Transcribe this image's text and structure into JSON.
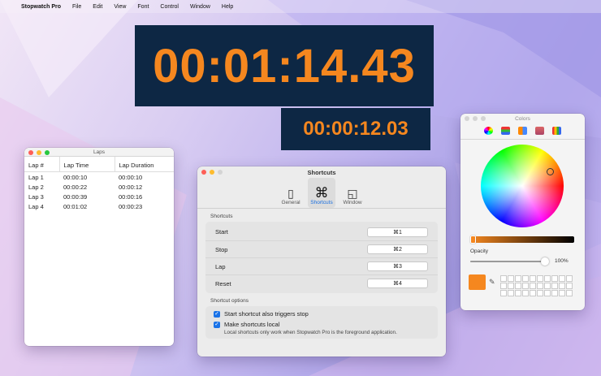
{
  "menubar": {
    "apple": "",
    "app_name": "Stopwatch Pro",
    "items": [
      "File",
      "Edit",
      "View",
      "Font",
      "Control",
      "Window",
      "Help"
    ]
  },
  "clock": {
    "main_time": "00:01:14.43",
    "lap_time": "00:00:12.03",
    "background": "#0d2744",
    "digit_color": "#f5871f"
  },
  "laps_window": {
    "title": "Laps",
    "columns": [
      "Lap #",
      "Lap Time",
      "Lap Duration"
    ],
    "rows": [
      [
        "Lap 1",
        "00:00:10",
        "00:00:10"
      ],
      [
        "Lap 2",
        "00:00:22",
        "00:00:12"
      ],
      [
        "Lap 3",
        "00:00:39",
        "00:00:16"
      ],
      [
        "Lap 4",
        "00:01:02",
        "00:00:23"
      ]
    ]
  },
  "shortcuts_window": {
    "title": "Shortcuts",
    "tabs": [
      {
        "label": "General",
        "icon": "switch-icon",
        "glyph": "▯"
      },
      {
        "label": "Shortcuts",
        "icon": "command-icon",
        "glyph": "⌘"
      },
      {
        "label": "Window",
        "icon": "window-icon",
        "glyph": "◱"
      }
    ],
    "section_title": "Shortcuts",
    "shortcuts": [
      {
        "label": "Start",
        "key": "⌘1"
      },
      {
        "label": "Stop",
        "key": "⌘2"
      },
      {
        "label": "Lap",
        "key": "⌘3"
      },
      {
        "label": "Reset",
        "key": "⌘4"
      }
    ],
    "options_title": "Shortcut options",
    "options": [
      {
        "label": "Start shortcut also triggers stop",
        "checked": true
      },
      {
        "label": "Make shortcuts local",
        "checked": true
      }
    ],
    "hint": "Local shortcuts only work when Stopwatch Pro is the foreground application."
  },
  "colors_window": {
    "title": "Colors",
    "tab_icons": [
      "color-wheel-icon",
      "color-sliders-icon",
      "color-palettes-icon",
      "image-palettes-icon",
      "pencils-icon"
    ],
    "selected_color": "#f5871f",
    "brightness": 0.0,
    "opacity_label": "Opacity",
    "opacity": 1.0,
    "opacity_value": "100%"
  }
}
